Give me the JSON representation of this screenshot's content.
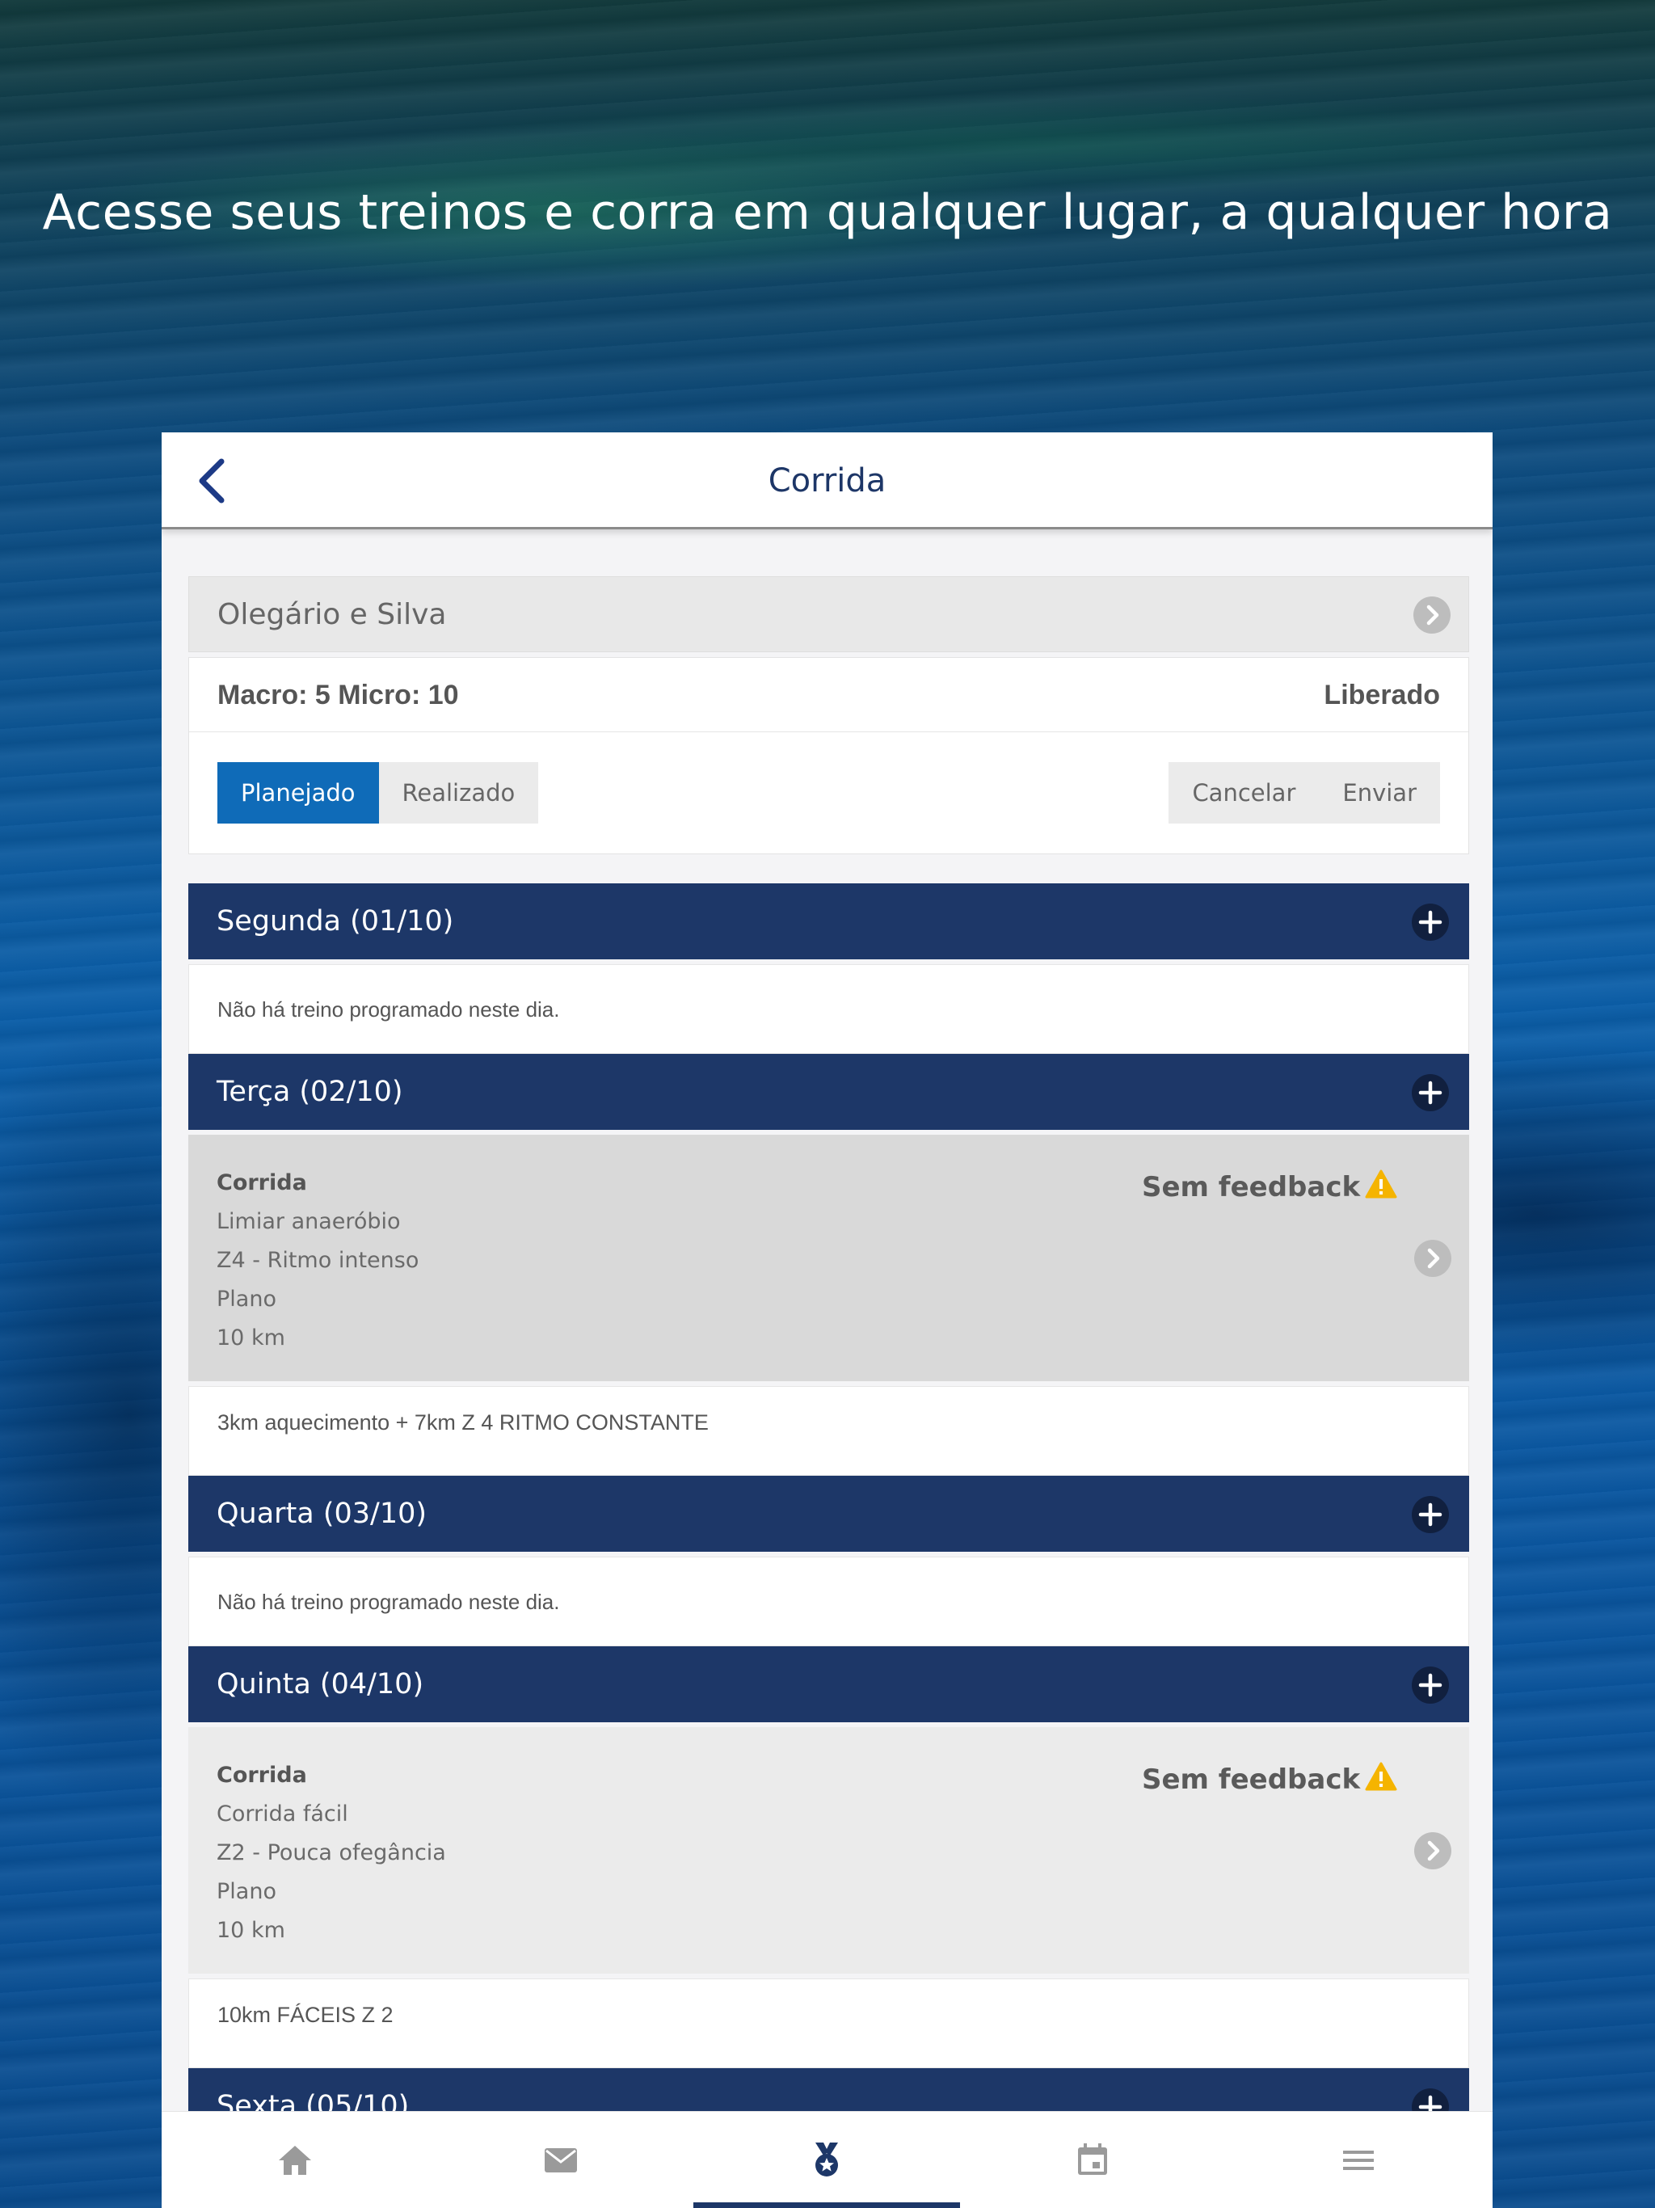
{
  "headline": "Acesse seus treinos e corra em qualquer lugar, a qualquer hora",
  "navbar": {
    "title": "Corrida",
    "back_icon": "chevron-left-icon"
  },
  "athlete": {
    "name": "Olegário e Silva"
  },
  "plan": {
    "macro_micro": "Macro: 5 Micro: 10",
    "status": "Liberado",
    "tabs": [
      {
        "label": "Planejado",
        "active": true
      },
      {
        "label": "Realizado",
        "active": false
      }
    ],
    "actions": {
      "cancel": "Cancelar",
      "send": "Enviar"
    }
  },
  "days": [
    {
      "title": "Segunda (01/10)",
      "empty_text": "Não há treino programado neste dia."
    },
    {
      "title": "Terça (02/10)",
      "workout": {
        "type": "Corrida",
        "lines": [
          "Limiar anaeróbio",
          "Z4 - Ritmo intenso",
          "Plano",
          "10 km"
        ],
        "feedback": "Sem feedback"
      },
      "note": "3km aquecimento + 7km Z 4 RITMO CONSTANTE"
    },
    {
      "title": "Quarta (03/10)",
      "empty_text": "Não há treino programado neste dia."
    },
    {
      "title": "Quinta (04/10)",
      "workout": {
        "type": "Corrida",
        "lines": [
          "Corrida fácil",
          "Z2 - Pouca ofegância",
          "Plano",
          "10 km"
        ],
        "feedback": "Sem feedback"
      },
      "note": "10km FÁCEIS Z 2"
    },
    {
      "title": "Sexta (05/10)"
    }
  ],
  "tabbar": {
    "items": [
      "home-icon",
      "mail-icon",
      "medal-icon",
      "calendar-icon",
      "menu-icon"
    ],
    "active_index": 2
  },
  "colors": {
    "header_blue": "#1d3768",
    "active_tab_blue": "#0f6bb8",
    "warning": "#f5b400"
  }
}
